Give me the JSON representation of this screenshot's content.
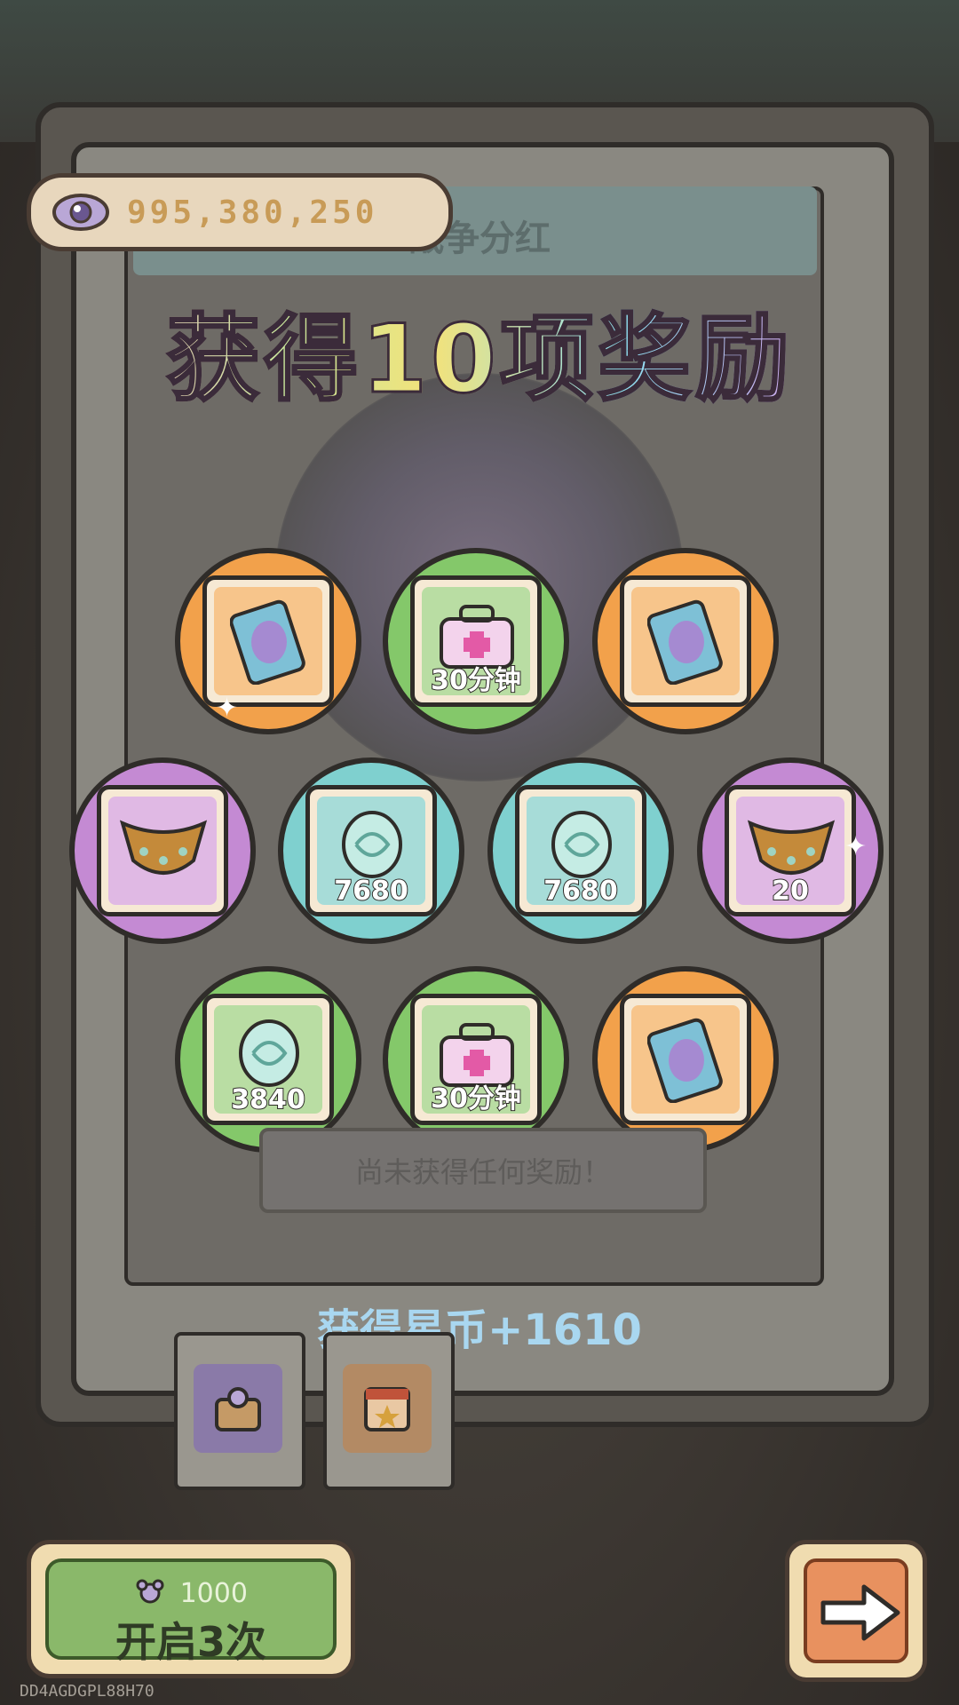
{
  "header": {
    "currency_icon": "eye-icon",
    "currency_value": "995,380,250"
  },
  "panel": {
    "title": "战争分红",
    "headline": "获得10项奖励",
    "empty_text": "尚未获得任何奖励！",
    "coins_text": "获得星币+1610"
  },
  "rewards": [
    {
      "item": "tablet-icon",
      "qty": "",
      "color": "orange"
    },
    {
      "item": "toolbox-icon",
      "qty": "30分钟",
      "color": "green"
    },
    {
      "item": "tablet-icon",
      "qty": "",
      "color": "orange"
    },
    {
      "item": "necklace-icon",
      "qty": "",
      "color": "purple"
    },
    {
      "item": "stone-icon",
      "qty": "7680",
      "color": "teal"
    },
    {
      "item": "stone-icon",
      "qty": "7680",
      "color": "teal"
    },
    {
      "item": "necklace-icon",
      "qty": "20",
      "color": "purple"
    },
    {
      "item": "stone-icon",
      "qty": "3840",
      "color": "green"
    },
    {
      "item": "toolbox-icon",
      "qty": "30分钟",
      "color": "green"
    },
    {
      "item": "tablet-icon",
      "qty": "",
      "color": "orange"
    }
  ],
  "buttons": {
    "open_cost": "1000",
    "open_label": "开启3次",
    "next_icon": "arrow-right-icon"
  },
  "footer": {
    "code": "DD4AGDGPL88H70"
  }
}
